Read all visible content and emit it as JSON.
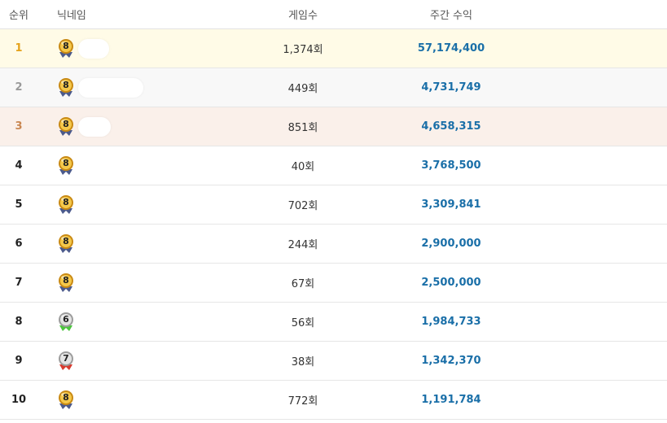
{
  "header": {
    "rank": "순위",
    "nickname": "닉네임",
    "games": "게임수",
    "earnings": "주간 수익"
  },
  "rows": [
    {
      "rank": "1",
      "level": "8",
      "games": "1,374회",
      "earnings": "57,174,400"
    },
    {
      "rank": "2",
      "level": "8",
      "games": "449회",
      "earnings": "4,731,749"
    },
    {
      "rank": "3",
      "level": "8",
      "games": "851회",
      "earnings": "4,658,315"
    },
    {
      "rank": "4",
      "level": "8",
      "games": "40회",
      "earnings": "3,768,500"
    },
    {
      "rank": "5",
      "level": "8",
      "games": "702회",
      "earnings": "3,309,841"
    },
    {
      "rank": "6",
      "level": "8",
      "games": "244회",
      "earnings": "2,900,000"
    },
    {
      "rank": "7",
      "level": "8",
      "games": "67회",
      "earnings": "2,500,000"
    },
    {
      "rank": "8",
      "level": "6",
      "games": "56회",
      "earnings": "1,984,733"
    },
    {
      "rank": "9",
      "level": "7",
      "games": "38회",
      "earnings": "1,342,370"
    },
    {
      "rank": "10",
      "level": "8",
      "games": "772회",
      "earnings": "1,191,784"
    }
  ],
  "colors": {
    "gold_rank": "#e5a21a",
    "silver_rank": "#9a9a9a",
    "bronze_rank": "#c98752",
    "earnings": "#1a6fa8",
    "row_top1_bg": "#fffbe7",
    "row_top2_bg": "#f8f8f8",
    "row_top3_bg": "#faf0ea"
  },
  "icons": {
    "level_8": "gold-medal-level-icon",
    "level_7": "silver-medal-red-ribbon-icon",
    "level_6": "silver-medal-green-ribbon-icon"
  }
}
